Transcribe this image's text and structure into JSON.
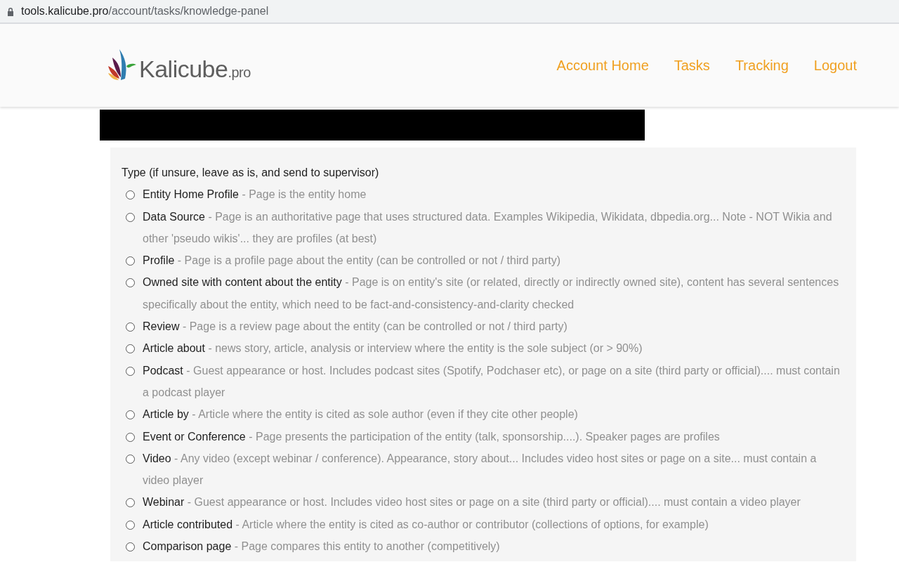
{
  "address_bar": {
    "host": "tools.kalicube.pro",
    "path": "/account/tasks/knowledge-panel"
  },
  "logo": {
    "name": "Kalicube",
    "suffix": ".pro"
  },
  "nav": [
    {
      "label": "Account Home"
    },
    {
      "label": "Tasks"
    },
    {
      "label": "Tracking"
    },
    {
      "label": "Logout"
    }
  ],
  "form": {
    "question": "Type (if unsure, leave as is, and send to supervisor)",
    "options": [
      {
        "label": "Entity Home Profile",
        "description": "- Page is the entity home",
        "selected": false
      },
      {
        "label": "Data Source",
        "description": "- Page is an authoritative page that uses structured data. Examples Wikipedia, Wikidata, dbpedia.org... Note - NOT Wikia and other 'pseudo wikis'... they are profiles (at best)",
        "selected": false
      },
      {
        "label": "Profile",
        "description": "- Page is a profile page about the entity (can be controlled or not / third party)",
        "selected": false
      },
      {
        "label": "Owned site with content about the entity",
        "description": "- Page is on entity's site (or related, directly or indirectly owned site), content has several sentences specifically about the entity, which need to be fact-and-consistency-and-clarity checked",
        "selected": false
      },
      {
        "label": "Review",
        "description": "- Page is a review page about the entity (can be controlled or not / third party)",
        "selected": false
      },
      {
        "label": "Article about",
        "description": "- news story, article, analysis or interview where the entity is the sole subject (or > 90%)",
        "selected": false
      },
      {
        "label": "Podcast",
        "description": "- Guest appearance or host. Includes podcast sites (Spotify, Podchaser etc), or page on a site (third party or official).... must contain a podcast player",
        "selected": false
      },
      {
        "label": "Article by",
        "description": "- Article where the entity is cited as sole author (even if they cite other people)",
        "selected": false
      },
      {
        "label": "Event or Conference",
        "description": "- Page presents the participation of the entity (talk, sponsorship....). Speaker pages are profiles",
        "selected": false
      },
      {
        "label": "Video",
        "description": "- Any video (except webinar / conference). Appearance, story about... Includes video host sites or page on a site... must contain a video player",
        "selected": false
      },
      {
        "label": "Webinar",
        "description": "- Guest appearance or host. Includes video host sites or page on a site (third party or official).... must contain a video player",
        "selected": false
      },
      {
        "label": "Article contributed",
        "description": "- Article where the entity is cited as co-author or contributor (collections of options, for example)",
        "selected": false
      },
      {
        "label": "Comparison page",
        "description": "- Page compares this entity to another (competitively)",
        "selected": false
      }
    ]
  }
}
